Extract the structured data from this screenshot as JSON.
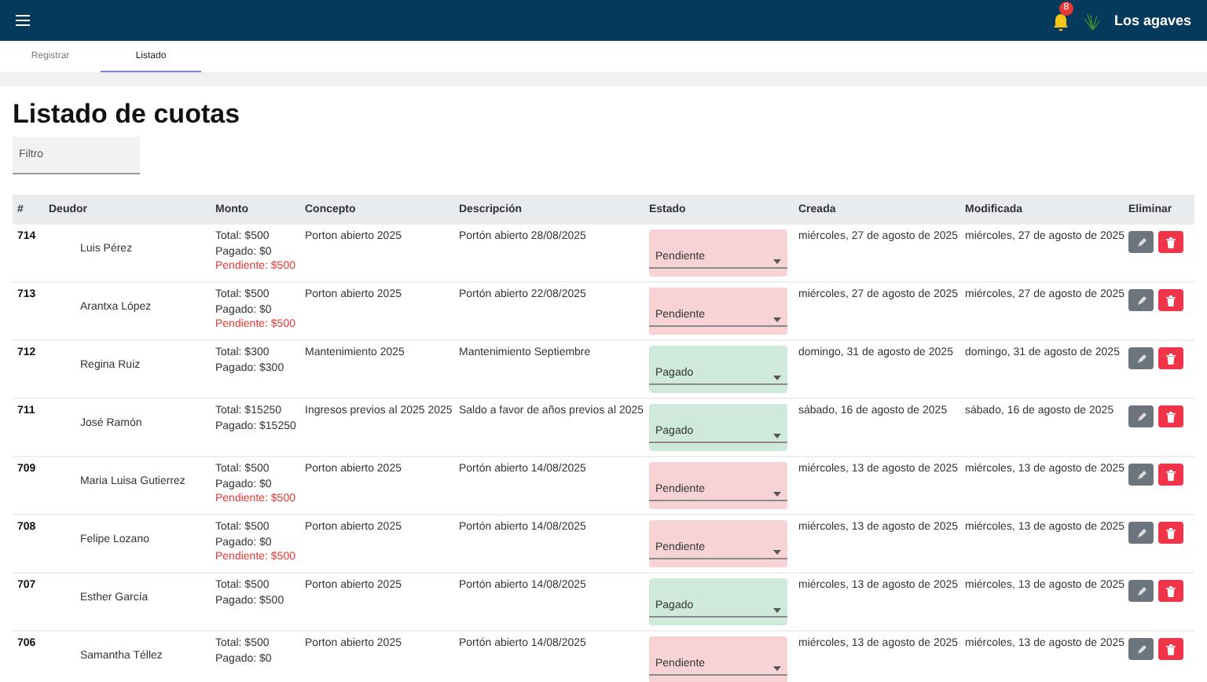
{
  "header": {
    "notifications": "8",
    "brand": "Los agaves"
  },
  "tabs": [
    {
      "label": "Registrar",
      "selected": false
    },
    {
      "label": "Listado",
      "selected": true
    }
  ],
  "title": "Listado de cuotas",
  "filter": {
    "placeholder": "Filtro"
  },
  "table": {
    "columns": [
      "#",
      "Deudor",
      "Monto",
      "Concepto",
      "Descripción",
      "Estado",
      "Creada",
      "Modificada",
      "Eliminar"
    ],
    "rows": [
      {
        "id": "714",
        "debtor": "Luis Pérez",
        "total": "Total: $500",
        "paid": "Pagado: $0",
        "pending": "Pendiente: $500",
        "concept": "Porton abierto 2025",
        "description": "Portón abierto 28/08/2025",
        "status": {
          "label": "Pendiente",
          "kind": "pending"
        },
        "created": "miércoles, 27 de agosto de 2025",
        "modified": "miércoles, 27 de agosto de 2025"
      },
      {
        "id": "713",
        "debtor": "Arantxa López",
        "total": "Total: $500",
        "paid": "Pagado: $0",
        "pending": "Pendiente: $500",
        "concept": "Porton abierto 2025",
        "description": "Portón abierto 22/08/2025",
        "status": {
          "label": "Pendiente",
          "kind": "pending"
        },
        "created": "miércoles, 27 de agosto de 2025",
        "modified": "miércoles, 27 de agosto de 2025"
      },
      {
        "id": "712",
        "debtor": "Regina Ruiz",
        "total": "Total: $300",
        "paid": "Pagado: $300",
        "concept": "Mantenimiento 2025",
        "description": "Mantenimiento Septiembre",
        "status": {
          "label": "Pagado",
          "kind": "paid"
        },
        "created": "domingo, 31 de agosto de 2025",
        "modified": "domingo, 31 de agosto de 2025"
      },
      {
        "id": "711",
        "debtor": "José Ramón",
        "total": "Total: $15250",
        "paid": "Pagado: $15250",
        "concept": "Ingresos previos al 2025 2025",
        "description": "Saldo a favor de años previos al 2025",
        "status": {
          "label": "Pagado",
          "kind": "paid"
        },
        "created": "sábado, 16 de agosto de 2025",
        "modified": "sábado, 16 de agosto de 2025"
      },
      {
        "id": "709",
        "debtor": "Maria Luisa Gutierrez",
        "total": "Total: $500",
        "paid": "Pagado: $0",
        "pending": "Pendiente: $500",
        "concept": "Porton abierto 2025",
        "description": "Portón abierto 14/08/2025",
        "status": {
          "label": "Pendiente",
          "kind": "pending"
        },
        "created": "miércoles, 13 de agosto de 2025",
        "modified": "miércoles, 13 de agosto de 2025"
      },
      {
        "id": "708",
        "debtor": "Felipe Lozano",
        "total": "Total: $500",
        "paid": "Pagado: $0",
        "pending": "Pendiente: $500",
        "concept": "Porton abierto 2025",
        "description": "Portón abierto 14/08/2025",
        "status": {
          "label": "Pendiente",
          "kind": "pending"
        },
        "created": "miércoles, 13 de agosto de 2025",
        "modified": "miércoles, 13 de agosto de 2025"
      },
      {
        "id": "707",
        "debtor": "Esther García",
        "total": "Total: $500",
        "paid": "Pagado: $500",
        "concept": "Porton abierto 2025",
        "description": "Portón abierto 14/08/2025",
        "status": {
          "label": "Pagado",
          "kind": "paid"
        },
        "created": "miércoles, 13 de agosto de 2025",
        "modified": "miércoles, 13 de agosto de 2025"
      },
      {
        "id": "706",
        "debtor": "Samantha Téllez",
        "total": "Total: $500",
        "paid": "Pagado: $0",
        "concept": "Porton abierto 2025",
        "description": "Portón abierto 14/08/2025",
        "status": {
          "label": "Pendiente",
          "kind": "pending"
        },
        "created": "miércoles, 13 de agosto de 2025",
        "modified": "miércoles, 13 de agosto de 2025"
      }
    ]
  }
}
